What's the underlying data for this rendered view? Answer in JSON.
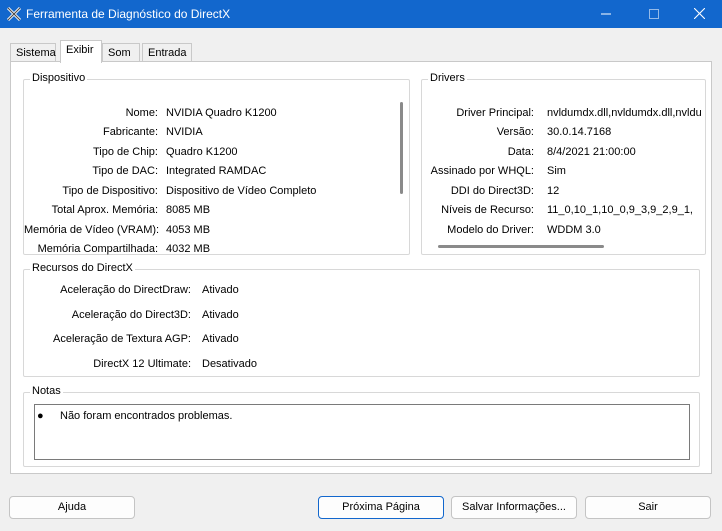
{
  "window": {
    "title": "Ferramenta de Diagnóstico do DirectX"
  },
  "tabs": [
    "Sistema",
    "Exibir",
    "Som",
    "Entrada"
  ],
  "device": {
    "title": "Dispositivo",
    "rows": [
      {
        "label": "Nome:",
        "value": "NVIDIA Quadro K1200"
      },
      {
        "label": "Fabricante:",
        "value": "NVIDIA"
      },
      {
        "label": "Tipo de Chip:",
        "value": "Quadro K1200"
      },
      {
        "label": "Tipo de DAC:",
        "value": "Integrated RAMDAC"
      },
      {
        "label": "Tipo de Dispositivo:",
        "value": "Dispositivo de Vídeo Completo"
      },
      {
        "label": "Total Aprox. Memória:",
        "value": "8085 MB"
      },
      {
        "label": "Memória de Vídeo (VRAM):",
        "value": "4053 MB"
      },
      {
        "label": "Memória Compartilhada:",
        "value": "4032 MB"
      }
    ]
  },
  "drivers": {
    "title": "Drivers",
    "rows": [
      {
        "label": "Driver Principal:",
        "value": "nvldumdx.dll,nvldumdx.dll,nvldu"
      },
      {
        "label": "Versão:",
        "value": "30.0.14.7168"
      },
      {
        "label": "Data:",
        "value": "8/4/2021 21:00:00"
      },
      {
        "label": "Assinado por WHQL:",
        "value": "Sim"
      },
      {
        "label": "DDI do Direct3D:",
        "value": "12"
      },
      {
        "label": "Níveis de Recurso:",
        "value": "11_0,10_1,10_0,9_3,9_2,9_1,"
      },
      {
        "label": "Modelo do Driver:",
        "value": "WDDM 3.0"
      }
    ]
  },
  "features": {
    "title": "Recursos do DirectX",
    "rows": [
      {
        "label": "Aceleração do DirectDraw:",
        "value": "Ativado"
      },
      {
        "label": "Aceleração do Direct3D:",
        "value": "Ativado"
      },
      {
        "label": "Aceleração de Textura AGP:",
        "value": "Ativado"
      },
      {
        "label": "DirectX 12 Ultimate:",
        "value": "Desativado"
      }
    ]
  },
  "notes": {
    "title": "Notas",
    "text": "Não foram encontrados problemas."
  },
  "buttons": {
    "help": "Ajuda",
    "next": "Próxima Página",
    "save": "Salvar Informações...",
    "exit": "Sair"
  }
}
